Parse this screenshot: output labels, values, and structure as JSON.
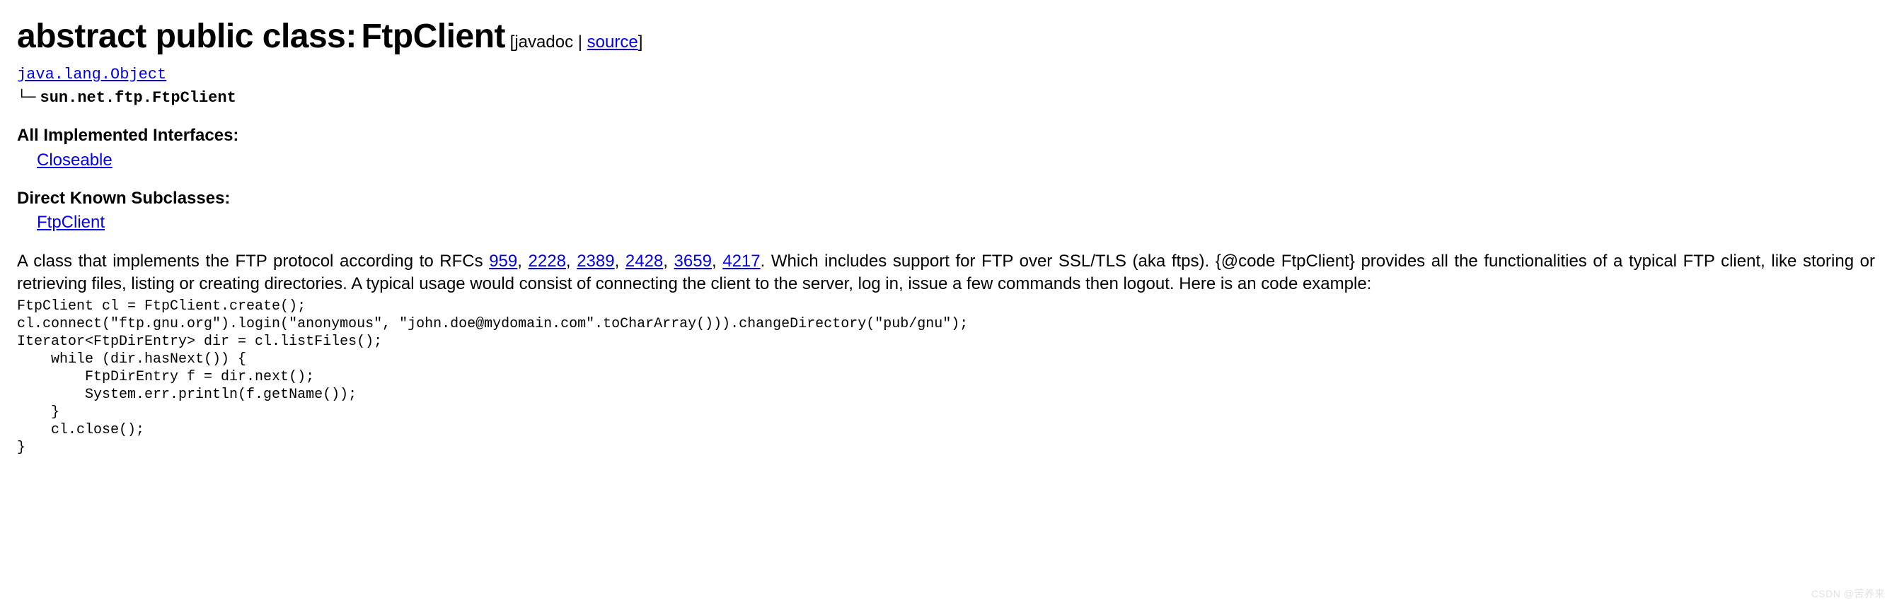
{
  "title": {
    "modifiers": "abstract public class:",
    "name": "FtpClient",
    "meta_open": " [",
    "javadoc_label": "javadoc",
    "sep": " | ",
    "source_label": "source",
    "meta_close": "]"
  },
  "hierarchy": {
    "root": "java.lang.Object",
    "tree_glyph": "   └─",
    "child": "sun.net.ftp.FtpClient"
  },
  "interfaces": {
    "heading": "All Implemented Interfaces:",
    "link": "Closeable"
  },
  "subclasses": {
    "heading": "Direct Known Subclasses:",
    "link": "FtpClient"
  },
  "description": {
    "pre_rfc": "A class that implements the FTP protocol according to RFCs ",
    "rfcs": [
      "959",
      "2228",
      "2389",
      "2428",
      "3659",
      "4217"
    ],
    "rfc_sep": ", ",
    "post_rfc": ". Which includes support for FTP over SSL/TLS (aka ftps). {@code FtpClient} provides all the functionalities of a typical FTP client, like storing or retrieving files, listing or creating directories. A typical usage would consist of connecting the client to the server, log in, issue a few commands then logout. Here is an code example:"
  },
  "code": "FtpClient cl = FtpClient.create();\ncl.connect(\"ftp.gnu.org\").login(\"anonymous\", \"john.doe@mydomain.com\".toCharArray())).changeDirectory(\"pub/gnu\");\nIterator<FtpDirEntry> dir = cl.listFiles();\n    while (dir.hasNext()) {\n        FtpDirEntry f = dir.next();\n        System.err.println(f.getName());\n    }\n    cl.close();\n}",
  "watermark": "CSDN @苦养来"
}
